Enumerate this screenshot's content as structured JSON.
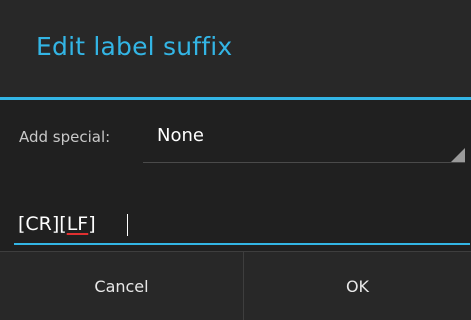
{
  "dialog": {
    "title": "Edit label suffix",
    "accent_color": "#33b5e5"
  },
  "special": {
    "label": "Add special:",
    "selected": "None"
  },
  "suffix_field": {
    "value": "[CR][LF]",
    "plain_part": "[CR][",
    "spellcheck_part": "LF",
    "end_part": "]"
  },
  "buttons": {
    "cancel": "Cancel",
    "ok": "OK"
  }
}
